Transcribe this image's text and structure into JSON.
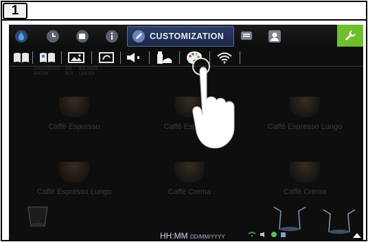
{
  "step_badge": "1",
  "topbar": {
    "customization_label": "CUSTOMIZATION",
    "icons": [
      "water-drop-icon",
      "clock-icon",
      "cup-icon",
      "info-icon",
      "pencil-icon",
      "monitor-icon",
      "user-icon",
      "wrench-icon"
    ],
    "accent_color": "#6fbe2c",
    "active_tab_color": "#2c3e67"
  },
  "subbar": {
    "icons": [
      "book-icon",
      "book-blue-icon",
      "image-icon",
      "screen-saver-icon",
      "speaker-icon",
      "bottle-cloud-icon",
      "palette-icon",
      "wifi-icon"
    ]
  },
  "background_labels": {
    "faint_left": [
      "CHOOSE",
      "HOT",
      "WATER"
    ],
    "faint_mid": [
      "NO",
      "BUY"
    ],
    "faint_right": [
      "BALANCE",
      "LIMITER"
    ]
  },
  "items": [
    {
      "label": "Caffè Espresso"
    },
    {
      "label": "Caffè Espresso"
    },
    {
      "label": "Caffè Espresso Lungo"
    },
    {
      "label": "Caffè Espresso Lungo"
    },
    {
      "label": "Caffè Crema"
    },
    {
      "label": "Caffè Crema"
    }
  ],
  "status": {
    "time": "HH:MM",
    "date": "DD/MM/YYYY"
  }
}
